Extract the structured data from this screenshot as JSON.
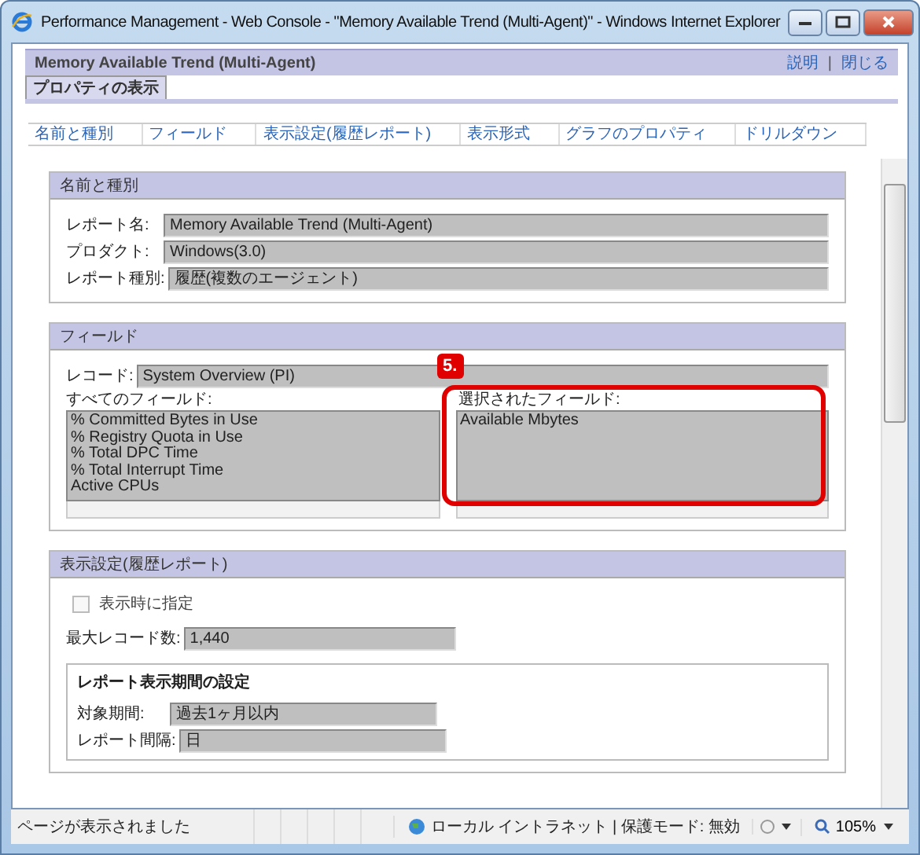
{
  "window": {
    "title": "Performance Management - Web Console - \"Memory Available Trend (Multi-Agent)\" - Windows Internet Explorer"
  },
  "header": {
    "title": "Memory Available Trend (Multi-Agent)",
    "links": [
      "説明",
      "閉じる"
    ],
    "separator": "|"
  },
  "tabs": [
    {
      "label": "プロパティの表示",
      "selected": true
    }
  ],
  "section_nav": [
    "名前と種別",
    "フィールド",
    "表示設定(履歴レポート)",
    "表示形式",
    "グラフのプロパティ",
    "ドリルダウン"
  ],
  "name_and_type": {
    "heading": "名前と種別",
    "fields": [
      {
        "label": "レポート名:",
        "value": "Memory Available Trend (Multi-Agent)"
      },
      {
        "label": "プロダクト:",
        "value": "Windows(3.0)"
      },
      {
        "label": "レポート種別:",
        "value": "履歴(複数のエージェント)"
      }
    ]
  },
  "fields": {
    "heading": "フィールド",
    "record": {
      "label": "レコード:",
      "value": "System Overview (PI)"
    },
    "all_fields": {
      "label": "すべてのフィールド:",
      "items": [
        "% Committed Bytes in Use",
        "% Registry Quota in Use",
        "% Total DPC Time",
        "% Total Interrupt Time",
        "Active CPUs"
      ]
    },
    "selected_fields": {
      "label": "選択されたフィールド:",
      "items": [
        "Available Mbytes"
      ]
    },
    "callout": "5."
  },
  "display_settings": {
    "heading": "表示設定(履歴レポート)",
    "specify_on_display": {
      "label": "表示時に指定",
      "checked": false,
      "disabled": true
    },
    "max_records": {
      "label": "最大レコード数:",
      "value": "1,440"
    },
    "period": {
      "heading": "レポート表示期間の設定",
      "fields": [
        {
          "label": "対象期間:",
          "value": "過去1ヶ月以内"
        },
        {
          "label": "レポート間隔:",
          "value": "日"
        }
      ]
    }
  },
  "status_bar": {
    "text": "ページが表示されました",
    "zone": "ローカル イントラネット | 保護モード: 無効",
    "zoom": "105%"
  }
}
